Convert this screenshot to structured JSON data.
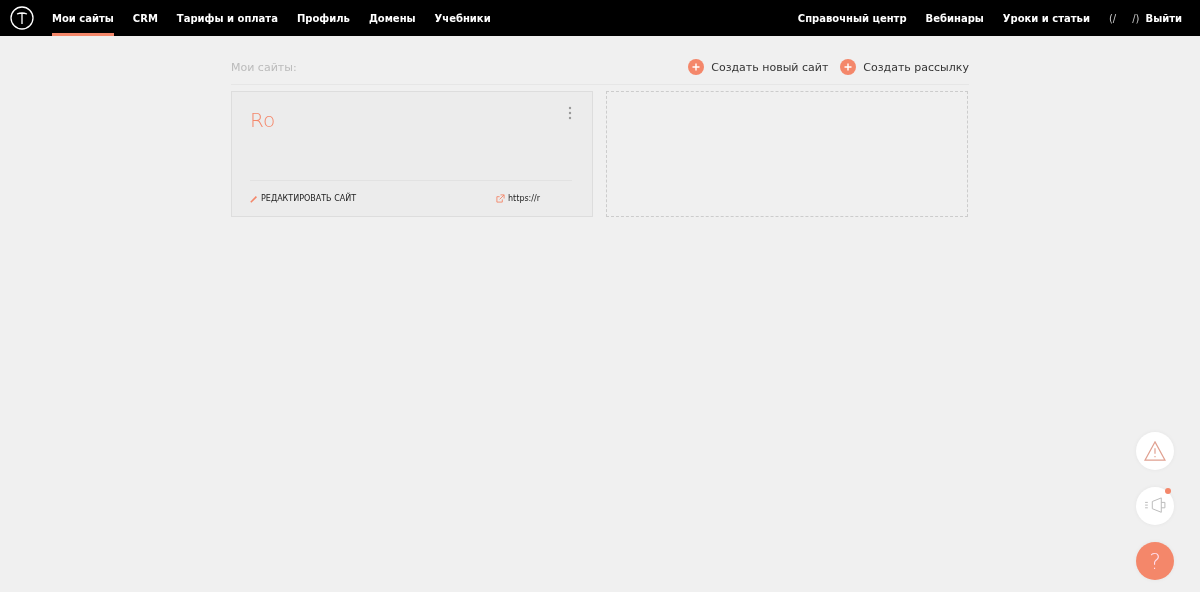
{
  "nav": {
    "items": [
      {
        "label": "Мои сайты",
        "selected": true
      },
      {
        "label": "CRM",
        "selected": false
      },
      {
        "label": "Тарифы и оплата",
        "selected": false
      },
      {
        "label": "Профиль",
        "selected": false
      },
      {
        "label": "Домены",
        "selected": false
      },
      {
        "label": "Учебники",
        "selected": false
      }
    ],
    "right_items": [
      "Справочный центр",
      "Вебинары",
      "Уроки и статьи"
    ],
    "user_fragments": [
      "(/",
      "/)"
    ],
    "logout": "Выйти"
  },
  "header": {
    "title": "Мои сайты:",
    "actions": [
      "Создать новый сайт",
      "Создать рассылку"
    ]
  },
  "sites": [
    {
      "name": "Ro",
      "edit_label": "РЕДАКТИРОВАТЬ САЙТ",
      "url": "https://r"
    }
  ],
  "floating": {
    "help": "?",
    "notification": true
  }
}
